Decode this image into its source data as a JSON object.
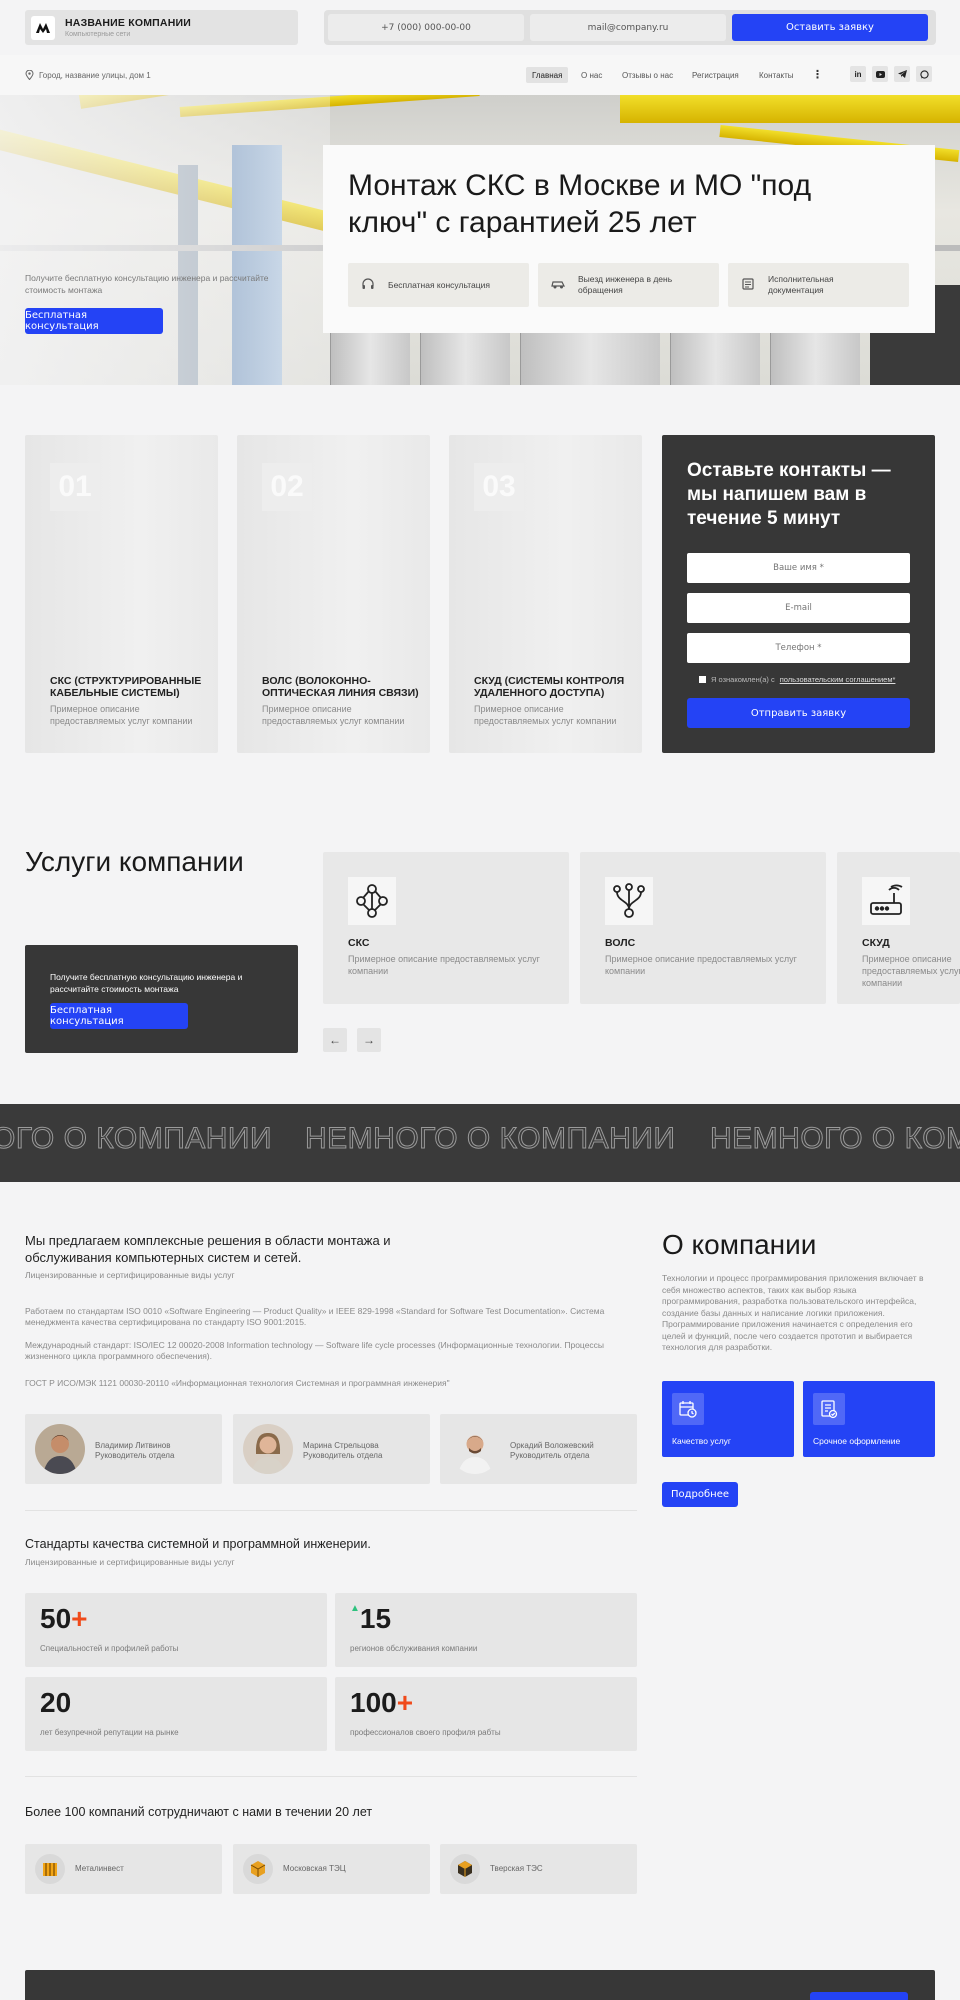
{
  "header": {
    "company_name": "НАЗВАНИЕ КОМПАНИИ",
    "company_sub": "Компьютерные сети",
    "phone": "+7 (000) 000-00-00",
    "email": "mail@company.ru",
    "cta": "Оставить заявку"
  },
  "nav": {
    "address": "Город, название улицы, дом 1",
    "items": [
      "Главная",
      "О нас",
      "Отзывы о нас",
      "Регистрация",
      "Контакты"
    ],
    "active": "Главная",
    "more_icon": "more-vertical-icon",
    "social": [
      "linkedin-icon",
      "youtube-icon",
      "telegram-icon",
      "whatsapp-icon"
    ]
  },
  "hero": {
    "title": "Монтаж СКС в Москве и МО \"под ключ\" с гарантией 25 лет",
    "text": "Получите бесплатную консультацию инженера и рассчитайте стоимость монтажа",
    "button": "Бесплатная консультация",
    "features": [
      {
        "icon": "headset-icon",
        "label": "Бесплатная консультация"
      },
      {
        "icon": "car-icon",
        "label": "Выезд инженера в день обращения"
      },
      {
        "icon": "document-icon",
        "label": "Исполнительная документация"
      }
    ]
  },
  "cards": [
    {
      "num": "01",
      "title": "СКС (СТРУКТУРИРОВАННЫЕ КАБЕЛЬНЫЕ СИСТЕМЫ)",
      "desc": "Примерное описание предоставляемых услуг компании"
    },
    {
      "num": "02",
      "title": "ВОЛС (ВОЛОКОННО-ОПТИЧЕСКАЯ ЛИНИЯ СВЯЗИ)",
      "desc": "Примерное описание предоставляемых услуг компании"
    },
    {
      "num": "03",
      "title": "СКУД (СИСТЕМЫ КОНТРОЛЯ УДАЛЕННОГО ДОСТУПА)",
      "desc": "Примерное описание предоставляемых услуг компании"
    }
  ],
  "form": {
    "title": "Оставьте контакты — мы напишем вам в течение 5 минут",
    "name_placeholder": "Ваше имя *",
    "email_placeholder": "E-mail",
    "phone_placeholder": "Телефон *",
    "agree_text": "Я ознакомлен(а) с",
    "agree_link": "пользовательским соглашением*",
    "submit": "Отправить заявку"
  },
  "services": {
    "title": "Услуги компании",
    "promo_text": "Получите бесплатную консультацию инженера и рассчитайте стоимость монтажа",
    "promo_button": "Бесплатная консультация",
    "items": [
      {
        "icon": "network-tree-icon",
        "name": "СКС",
        "desc": "Примерное описание предоставляемых услуг компании"
      },
      {
        "icon": "fiber-split-icon",
        "name": "ВОЛС",
        "desc": "Примерное описание предоставляемых услуг компании"
      },
      {
        "icon": "router-icon",
        "name": "СКУД",
        "desc": "Примерное описание предоставляемых услуг компании"
      }
    ]
  },
  "marquee": {
    "text": "НЕМНОГО О КОМПАНИИ",
    "visible_start": "ОГО О КОМПАНИИ",
    "visible_end": "НЕМНОГО О КОМП"
  },
  "about": {
    "offer_title": "Мы предлагаем комплексные решения в области монтажа и обслуживания компьютерных систем и сетей.",
    "licensed": "Лицензированные и сертифицированные виды услуг",
    "p1": "Работаем по стандартам ISO 0010 «Software Engineering — Product Quality» и IEEE 829-1998 «Standard for Software Test Documentation». Система менеджмента качества сертифицирована по стандарту ISO 9001:2015.",
    "p2": "Международный стандарт: ISO/IEC 12 00020-2008 Information technology — Software life cycle processes (Информационные технологии. Процессы жизненного цикла программного обеспечения).",
    "p3": "ГОСТ Р ИСО/МЭК 1121 00030-20110 «Информационная технология Системная и программная инженерия\"",
    "title": "О компании",
    "desc": "Технологии и процесс программирования приложения включает в себя множество аспектов, таких как выбор языка программирования, разработка пользовательского интерфейса, создание базы данных и написание логики приложения. Программирование приложения начинается с определения его целей и функций, после чего создается прототип и выбирается технология для разработки.",
    "blue_cards": [
      {
        "icon": "calendar-clock-icon",
        "label": "Качество услуг"
      },
      {
        "icon": "checklist-icon",
        "label": "Срочное оформление"
      }
    ],
    "more_button": "Подробнее",
    "people": [
      {
        "name": "Владимир Литвинов",
        "role": "Руководитель отдела"
      },
      {
        "name": "Марина Стрельцова",
        "role": "Руководитель отдела"
      },
      {
        "name": "Оркадий Воложевский",
        "role": "Руководитель отдела"
      }
    ]
  },
  "standards": {
    "title": "Стандарты качества системной и программной инженерии.",
    "sub": "Лицензированные и сертифицированные виды услуг",
    "stats": [
      {
        "prefix": "",
        "value": "50",
        "suffix": "+",
        "label": "Специальностей и профилей работы"
      },
      {
        "prefix": "▲",
        "value": "15",
        "suffix": "",
        "label": "регионов обслуживания компании"
      },
      {
        "prefix": "",
        "value": "20",
        "suffix": "",
        "label": "лет безупречной репутации на рынке"
      },
      {
        "prefix": "",
        "value": "100",
        "suffix": "+",
        "label": "профессионалов своего профиля рабты"
      }
    ],
    "colors": {
      "plus": "#f04a1a",
      "up_arrow": "#2ec27e"
    }
  },
  "partners": {
    "title": "Более 100 компаний сотрудничают с нами в течении 20 лет",
    "items": [
      {
        "icon": "box-logo-icon",
        "name": "Металинвест"
      },
      {
        "icon": "cube-logo-icon",
        "name": "Московская ТЭЦ"
      },
      {
        "icon": "cube-dark-logo-icon",
        "name": "Тверская ТЭС"
      }
    ]
  },
  "colors": {
    "accent": "#2443f5",
    "dark": "#373737",
    "bg": "#f4f4f5"
  }
}
